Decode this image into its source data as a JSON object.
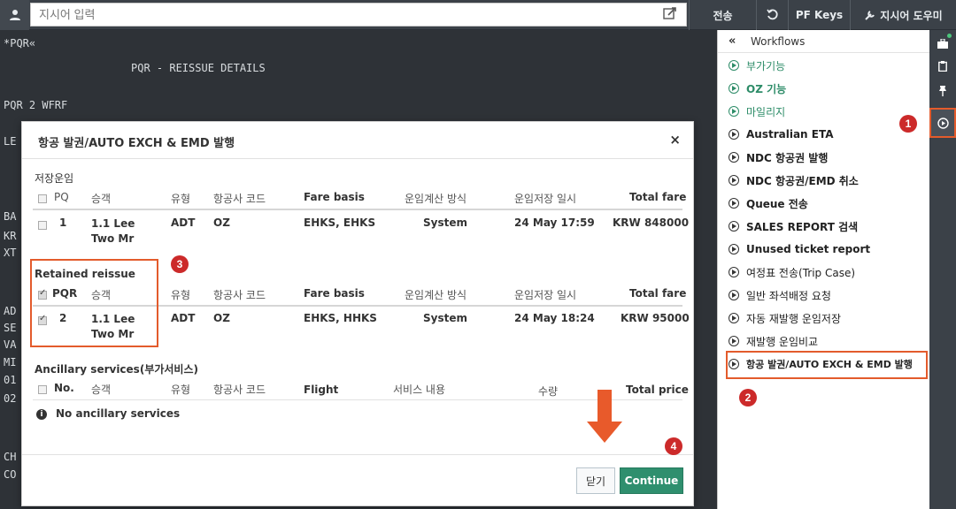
{
  "topbar": {
    "input_placeholder": "지시어 입력",
    "send_label": "전송",
    "pfkeys_label": "PF Keys",
    "help_label": "지시어 도우미"
  },
  "terminal": {
    "lines": [
      "*PQR«",
      "PQR - REISSUE DETAILS",
      "PQR 2 WFRF",
      "LE",
      "BA",
      "KR",
      "XT",
      "AD",
      "SE",
      "VA",
      "MI",
      "01",
      "02",
      "CH",
      "CO"
    ]
  },
  "modal": {
    "title": "항공 발권/AUTO EXCH & EMD 발행",
    "close_symbol": "×",
    "stored": {
      "title": "저장운임",
      "headers": [
        "PQ",
        "승객",
        "유형",
        "항공사 코드",
        "Fare basis",
        "운임계산 방식",
        "운임저장 일시",
        "Total fare"
      ],
      "row": {
        "pq": "1",
        "pax": "1.1 Lee Two Mr",
        "type": "ADT",
        "airline": "OZ",
        "fare_basis": "EHKS, EHKS",
        "calc": "System",
        "saved": "24 May 17:59",
        "total": "KRW 848000"
      }
    },
    "retained": {
      "title": "Retained reissue",
      "headers": [
        "PQR",
        "승객",
        "유형",
        "항공사 코드",
        "Fare basis",
        "운임계산 방식",
        "운임저장 일시",
        "Total fare"
      ],
      "row": {
        "pq": "2",
        "pax": "1.1 Lee Two Mr",
        "type": "ADT",
        "airline": "OZ",
        "fare_basis": "EHKS, HHKS",
        "calc": "System",
        "saved": "24 May 18:24",
        "total": "KRW 95000"
      }
    },
    "ancillary": {
      "title": "Ancillary services(부가서비스)",
      "headers": [
        "No.",
        "승객",
        "유형",
        "항공사 코드",
        "Flight",
        "서비스 내용",
        "수량",
        "Total price"
      ],
      "empty_text": "No ancillary services"
    },
    "close_button": "닫기",
    "continue_button": "Continue"
  },
  "workflows": {
    "header": "Workflows",
    "items": [
      {
        "label": "부가기능",
        "style": "green"
      },
      {
        "label": "OZ 기능",
        "style": "green"
      },
      {
        "label": "마일리지",
        "style": "green"
      },
      {
        "label": "Australian ETA",
        "style": "bold"
      },
      {
        "label": "NDC 항공권 발행",
        "style": "bold"
      },
      {
        "label": "NDC 항공권/EMD 취소",
        "style": "bold"
      },
      {
        "label": "Queue 전송",
        "style": "bold"
      },
      {
        "label": "SALES REPORT 검색",
        "style": "bold"
      },
      {
        "label": "Unused ticket report",
        "style": "bold"
      },
      {
        "label": "여정표 전송(Trip Case)",
        "style": "normal"
      },
      {
        "label": "일반 좌석배정 요청",
        "style": "normal"
      },
      {
        "label": "자동 재발행 운임저장",
        "style": "normal"
      },
      {
        "label": "재발행 운임비교",
        "style": "normal"
      },
      {
        "label": "항공 발권/AUTO EXCH & EMD 발행",
        "style": "bold"
      }
    ]
  },
  "annotations": {
    "badge1": "1",
    "badge2": "2",
    "badge3": "3",
    "badge4": "4"
  },
  "colors": {
    "accent_green": "#2f8f6e",
    "highlight_orange": "#e35b2c",
    "badge_red": "#cc2a2a",
    "topbar_bg": "#3b4148",
    "terminal_bg": "#2e3237"
  }
}
